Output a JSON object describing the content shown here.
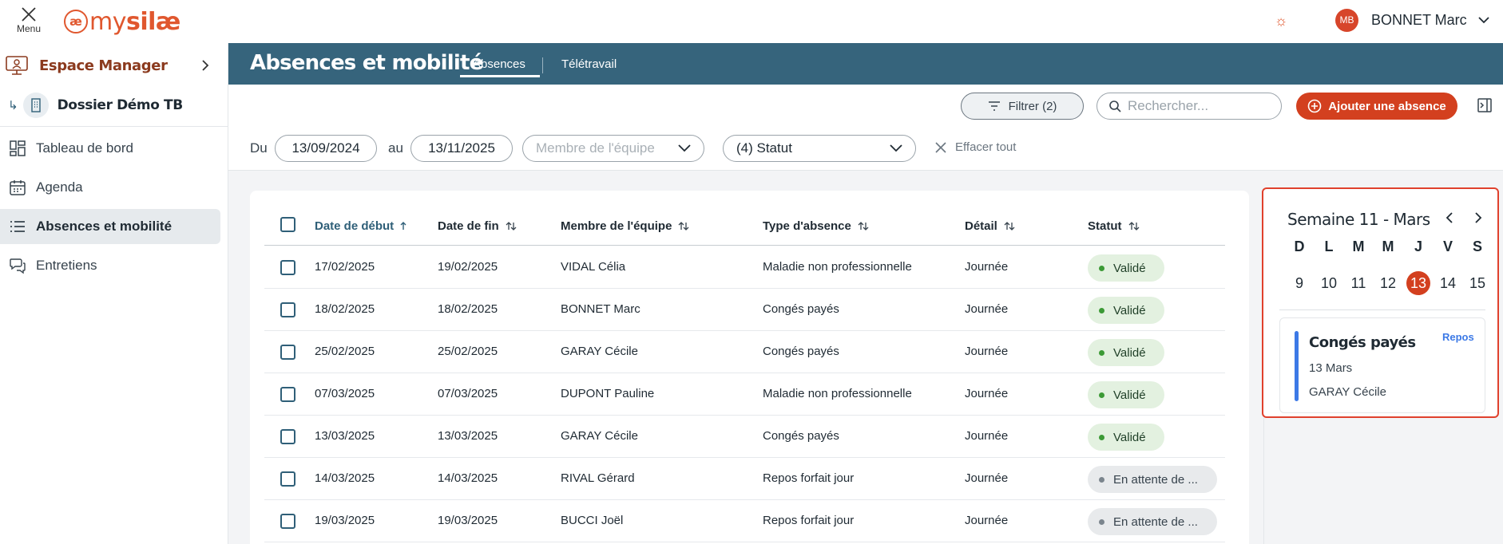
{
  "topbar": {
    "menu_label": "Menu",
    "logo_mark": "æ",
    "logo_my": "my",
    "logo_silae": "silæ",
    "user_initials": "MB",
    "user_name": "BONNET Marc"
  },
  "sidebar": {
    "espace_label": "Espace Manager",
    "dossier_label": "Dossier Démo TB",
    "items": [
      {
        "label": "Tableau de bord",
        "icon": "dashboard-icon",
        "active": false
      },
      {
        "label": "Agenda",
        "icon": "calendar-icon",
        "active": false
      },
      {
        "label": "Absences et mobilité",
        "icon": "list-icon",
        "active": true
      },
      {
        "label": "Entretiens",
        "icon": "chat-icon",
        "active": false
      }
    ]
  },
  "header": {
    "title": "Absences et mobilité",
    "tabs": [
      {
        "label": "Absences",
        "active": true
      },
      {
        "label": "Télétravail",
        "active": false
      }
    ]
  },
  "toolbar": {
    "filter_label": "Filtrer (2)",
    "search_placeholder": "Rechercher...",
    "add_label": "Ajouter une absence"
  },
  "filters": {
    "from_label": "Du",
    "from_value": "13/09/2024",
    "to_label": "au",
    "to_value": "13/11/2025",
    "member_placeholder": "Membre de l'équipe",
    "status_value": "(4) Statut",
    "clear_label": "Effacer tout"
  },
  "table": {
    "columns": [
      "Date de début",
      "Date de fin",
      "Membre de l'équipe",
      "Type d'absence",
      "Détail",
      "Statut"
    ],
    "rows": [
      {
        "start": "17/02/2025",
        "end": "19/02/2025",
        "member": "VIDAL Célia",
        "type": "Maladie non professionnelle",
        "detail": "Journée",
        "status": "Validé",
        "status_kind": "ok"
      },
      {
        "start": "18/02/2025",
        "end": "18/02/2025",
        "member": "BONNET Marc",
        "type": "Congés payés",
        "detail": "Journée",
        "status": "Validé",
        "status_kind": "ok"
      },
      {
        "start": "25/02/2025",
        "end": "25/02/2025",
        "member": "GARAY Cécile",
        "type": "Congés payés",
        "detail": "Journée",
        "status": "Validé",
        "status_kind": "ok"
      },
      {
        "start": "07/03/2025",
        "end": "07/03/2025",
        "member": "DUPONT Pauline",
        "type": "Maladie non professionnelle",
        "detail": "Journée",
        "status": "Validé",
        "status_kind": "ok"
      },
      {
        "start": "13/03/2025",
        "end": "13/03/2025",
        "member": "GARAY Cécile",
        "type": "Congés payés",
        "detail": "Journée",
        "status": "Validé",
        "status_kind": "ok"
      },
      {
        "start": "14/03/2025",
        "end": "14/03/2025",
        "member": "RIVAL Gérard",
        "type": "Repos forfait jour",
        "detail": "Journée",
        "status": "En attente de ...",
        "status_kind": "wait"
      },
      {
        "start": "19/03/2025",
        "end": "19/03/2025",
        "member": "BUCCI Joël",
        "type": "Repos forfait jour",
        "detail": "Journée",
        "status": "En attente de ...",
        "status_kind": "wait"
      }
    ]
  },
  "calendar": {
    "title": "Semaine 11 - Mars",
    "weekdays": [
      "D",
      "L",
      "M",
      "M",
      "J",
      "V",
      "S"
    ],
    "days": [
      "9",
      "10",
      "11",
      "12",
      "13",
      "14",
      "15"
    ],
    "selected_day": "13",
    "event": {
      "title": "Congés payés",
      "tag": "Repos",
      "date": "13 Mars",
      "person": "GARAY Cécile"
    }
  },
  "colors": {
    "brand": "#e0572e",
    "header_band": "#36647c",
    "primary_button": "#d3401f",
    "ok_badge": "#e3f1e0",
    "wait_badge": "#e8eaec",
    "event_bar": "#3c79e6"
  }
}
